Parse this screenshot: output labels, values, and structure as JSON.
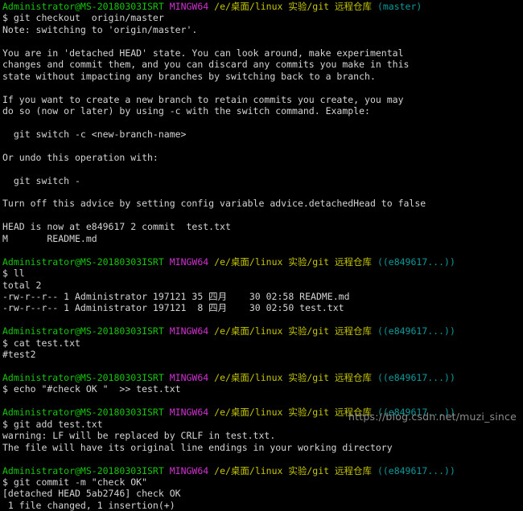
{
  "terminal": {
    "app": "MINGW64 git bash",
    "colors": {
      "background": "#000000",
      "foreground": "#d4d4d4",
      "user_host": "#16c60c",
      "shell": "#d033d0",
      "path": "#c5c500",
      "branch": "#0d9a9a",
      "watermark": "#8b8b8b"
    },
    "prompt": {
      "user_host": "Administrator@MS-20180303ISRT",
      "shell": "MINGW64",
      "path": "/e/桌面/linux 实验/git 远程仓库",
      "branch_master": "(master)",
      "branch_detached": "((e849617...))",
      "symbol": "$ "
    },
    "lines": [
      {
        "type": "prompt",
        "branch": "(master)"
      },
      {
        "type": "command",
        "text": "$ git checkout  origin/master"
      },
      {
        "type": "output",
        "text": "Note: switching to 'origin/master'."
      },
      {
        "type": "blank",
        "text": ""
      },
      {
        "type": "output",
        "text": "You are in 'detached HEAD' state. You can look around, make experimental"
      },
      {
        "type": "output",
        "text": "changes and commit them, and you can discard any commits you make in this"
      },
      {
        "type": "output",
        "text": "state without impacting any branches by switching back to a branch."
      },
      {
        "type": "blank",
        "text": ""
      },
      {
        "type": "output",
        "text": "If you want to create a new branch to retain commits you create, you may"
      },
      {
        "type": "output",
        "text": "do so (now or later) by using -c with the switch command. Example:"
      },
      {
        "type": "blank",
        "text": ""
      },
      {
        "type": "output",
        "text": "  git switch -c <new-branch-name>"
      },
      {
        "type": "blank",
        "text": ""
      },
      {
        "type": "output",
        "text": "Or undo this operation with:"
      },
      {
        "type": "blank",
        "text": ""
      },
      {
        "type": "output",
        "text": "  git switch -"
      },
      {
        "type": "blank",
        "text": ""
      },
      {
        "type": "output",
        "text": "Turn off this advice by setting config variable advice.detachedHead to false"
      },
      {
        "type": "blank",
        "text": ""
      },
      {
        "type": "output",
        "text": "HEAD is now at e849617 2 commit  test.txt"
      },
      {
        "type": "output",
        "text": "M       README.md"
      },
      {
        "type": "blank",
        "text": ""
      },
      {
        "type": "prompt",
        "branch": "((e849617...))"
      },
      {
        "type": "command",
        "text": "$ ll"
      },
      {
        "type": "output",
        "text": "total 2"
      },
      {
        "type": "output",
        "text": "-rw-r--r-- 1 Administrator 197121 35 四月    30 02:58 README.md"
      },
      {
        "type": "output",
        "text": "-rw-r--r-- 1 Administrator 197121  8 四月    30 02:50 test.txt"
      },
      {
        "type": "blank",
        "text": ""
      },
      {
        "type": "prompt",
        "branch": "((e849617...))"
      },
      {
        "type": "command",
        "text": "$ cat test.txt"
      },
      {
        "type": "output",
        "text": "#test2"
      },
      {
        "type": "blank",
        "text": ""
      },
      {
        "type": "prompt",
        "branch": "((e849617...))"
      },
      {
        "type": "command",
        "text": "$ echo \"#check OK \"  >> test.txt"
      },
      {
        "type": "blank",
        "text": ""
      },
      {
        "type": "prompt",
        "branch": "((e849617...))"
      },
      {
        "type": "command",
        "text": "$ git add test.txt"
      },
      {
        "type": "output",
        "text": "warning: LF will be replaced by CRLF in test.txt."
      },
      {
        "type": "output",
        "text": "The file will have its original line endings in your working directory"
      },
      {
        "type": "blank",
        "text": ""
      },
      {
        "type": "prompt",
        "branch": "((e849617...))"
      },
      {
        "type": "command",
        "text": "$ git commit -m \"check OK\""
      },
      {
        "type": "output",
        "text": "[detached HEAD 5ab2746] check OK"
      },
      {
        "type": "output",
        "text": " 1 file changed, 1 insertion(+)"
      }
    ]
  },
  "watermark": {
    "text": "https://blog.csdn.net/muzi_since"
  }
}
